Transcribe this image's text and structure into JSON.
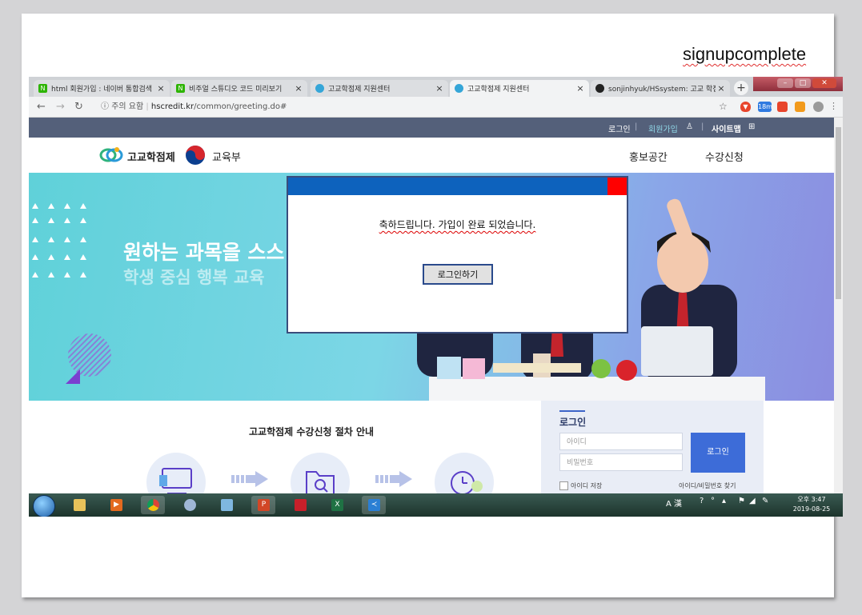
{
  "slide": {
    "title": "signupcomplete"
  },
  "browser": {
    "tabs": [
      {
        "title": "html 회원가입 : 네이버 통합검색",
        "icon": "naver-icon",
        "color": "#2db400",
        "active": false
      },
      {
        "title": "비주얼 스튜디오 코드 미리보기",
        "icon": "naver-icon",
        "color": "#2db400",
        "active": false
      },
      {
        "title": "고교학점제 지원센터",
        "icon": "hscredit-icon",
        "color": "#35a6d8",
        "active": false
      },
      {
        "title": "고교학점제 지원센터",
        "icon": "hscredit-icon",
        "color": "#35a6d8",
        "active": true
      },
      {
        "title": "sonjinhyuk/HSsystem: 고교 학점",
        "icon": "github-icon",
        "color": "#222222",
        "active": false
      }
    ],
    "tab_close": "×",
    "new_tab": "+",
    "security_label": "주의 요함",
    "url_host": "hscredit.kr",
    "url_path": "/common/greeting.do#",
    "ext_badge": "18m"
  },
  "site": {
    "util": {
      "login": "로그인",
      "signup": "회원가입",
      "sitemap": "사이트맵"
    },
    "logo_main": "고교학점제",
    "logo_ministry": "교육부",
    "menu": [
      "홍보공간",
      "수강신청"
    ],
    "hero_line1": "원하는 과목을 스스",
    "hero_line2": "학생 중심 행복 교육",
    "guide_title": "고교학점제 수강신청 절차 안내",
    "login_box": {
      "title": "로그인",
      "id_placeholder": "아이디",
      "pw_placeholder": "비밀번호",
      "button": "로그인",
      "remember": "아이디 저장",
      "find": "아이디/비밀번호 찾기"
    }
  },
  "popup": {
    "message": "축하드립니다. 가입이 완료 되었습니다.",
    "button": "로그인하기"
  },
  "taskbar": {
    "tray_lang": "A 漢",
    "time": "오후 3:47",
    "date": "2019-08-25"
  },
  "colors": {
    "popup_titlebar": "#0d62bd",
    "popup_close": "#ff0000",
    "util_bar": "#54607a",
    "login_button": "#3d6cd8"
  }
}
